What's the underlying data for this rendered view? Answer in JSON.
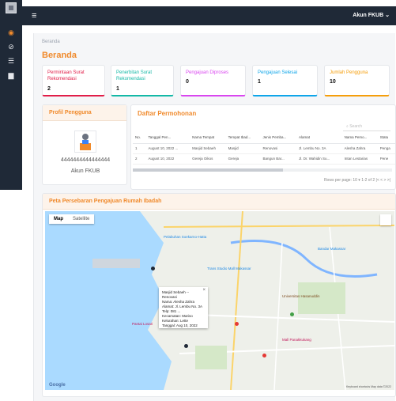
{
  "topbar": {
    "menu_icon": "hamburger-icon",
    "account_label": "Akun FKUB"
  },
  "sidebar": {
    "icons": [
      "dashboard-icon",
      "compass-icon",
      "list-icon",
      "document-icon"
    ]
  },
  "breadcrumb": "Beranda",
  "page_title": "Beranda",
  "stats": [
    {
      "label": "Permintaan Surat Rekomendasi",
      "value": "2",
      "color": "#e11d48"
    },
    {
      "label": "Penerbitan Surat Rekomendasi",
      "value": "1",
      "color": "#14b8a6"
    },
    {
      "label": "Pengajuan Diproses",
      "value": "0",
      "color": "#d946ef"
    },
    {
      "label": "Pengajuan Selesai",
      "value": "1",
      "color": "#0ea5e9"
    },
    {
      "label": "Jumlah Pengguna",
      "value": "10",
      "color": "#f59e0b"
    }
  ],
  "profile": {
    "title": "Profil Pengguna",
    "id_number": "4444444444444444",
    "name": "Akun FKUB"
  },
  "requests": {
    "title": "Daftar Permohonan",
    "search_placeholder": "Search",
    "columns": [
      "No.",
      "Tanggal Pen...",
      "Nama Tempat",
      "Tempat Ibad...",
      "Jenis Pemba...",
      "Alamat",
      "Nama Pemo...",
      "Statu"
    ],
    "rows": [
      [
        "1",
        "August 10, 2022 ...",
        "Masjid Sebaeh",
        "Masjid",
        "Renovasi",
        "Jl. Lembu No. 3A",
        "Alesha Zahra",
        "Penga"
      ],
      [
        "2",
        "August 10, 2022",
        "Gereja Oikos",
        "Gereja",
        "Bangun Bar...",
        "Jl. Dr. Wahidin Su...",
        "Intan Lestarias",
        "Pene"
      ]
    ],
    "pagination": "Rows per page: 10 ▾   1-2 of 2   |<  <  >  >|"
  },
  "map": {
    "title": "Peta Persebaran Pengajuan Rumah Ibadah",
    "tabs": [
      "Map",
      "Satellite"
    ],
    "popup": {
      "title": "Masjid Sebaeh -- Renovasi",
      "lines": [
        "Nama: Alesha Zahra",
        "Alamat: Jl. Lembu No. 3A",
        "Telp: 081 ...",
        "Kecamatan: Mariso",
        "Kelurahan: Lette",
        "Tanggal: Aug 10, 2022"
      ]
    },
    "labels": [
      "Pelabuhan Soekarno-Hatta",
      "Trans Studio Mall Makassar",
      "Universitas Hasanuddin",
      "Pantai Losari",
      "Mall Panakkukang",
      "Bandar Makassar"
    ],
    "attribution": "Keyboard shortcuts   Map data ©2022",
    "logo": "Google"
  }
}
